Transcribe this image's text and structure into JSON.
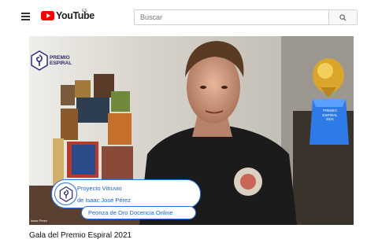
{
  "header": {
    "logo_text": "YouTube",
    "region": "ES",
    "search_placeholder": "Buscar"
  },
  "overlay": {
    "brand_line1": "PREMIO",
    "brand_line2": "ESPIRAL",
    "project_line1": "Proyecto Vitruvio",
    "project_line2": "de Isaac José Pérez",
    "award": "Peonza de Oro Docencia Online",
    "camera_label": "Isaac Pérez",
    "trophy_line1": "PREMIO",
    "trophy_line2": "ESPIRAL",
    "trophy_line3": "2021"
  },
  "video": {
    "title": "Gala del Premio Espiral 2021"
  },
  "colors": {
    "brand_red": "#ff0000",
    "overlay_blue": "#2c6fe0"
  },
  "icons": [
    "menu-icon",
    "youtube-logo-icon",
    "search-icon",
    "spiral-logo-icon",
    "trophy-icon"
  ]
}
